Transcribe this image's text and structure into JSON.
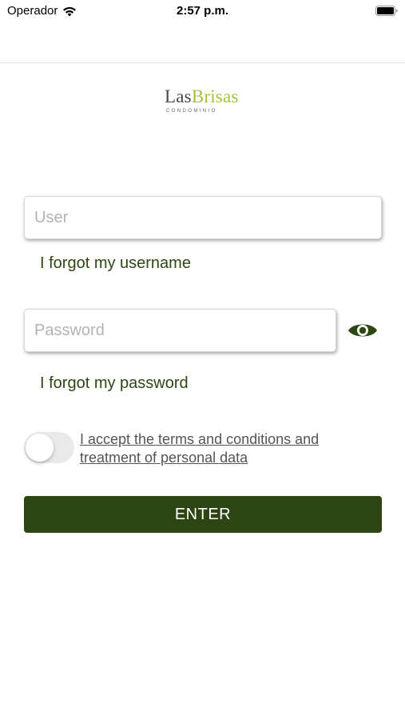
{
  "status_bar": {
    "carrier": "Operador",
    "time": "2:57 p.m.",
    "wifi_icon": "wifi-icon",
    "battery_icon": "battery-full-icon"
  },
  "logo": {
    "part1": "Las",
    "part2": "Brisas",
    "subtitle": "CONDOMINIO",
    "colors": {
      "las": "#4a4a4a",
      "brisas": "#a5c13a"
    }
  },
  "form": {
    "user": {
      "placeholder": "User",
      "value": ""
    },
    "forgot_username": "I forgot my username",
    "password": {
      "placeholder": "Password",
      "value": "",
      "toggle_icon": "eye-icon"
    },
    "forgot_password": "I forgot my password",
    "terms": {
      "accepted": false,
      "label": "I accept the terms and conditions and treatment of personal data"
    },
    "enter_label": "ENTER"
  },
  "colors": {
    "primary": "#2c4512",
    "link": "#2d4712",
    "accent": "#a5c13a"
  }
}
